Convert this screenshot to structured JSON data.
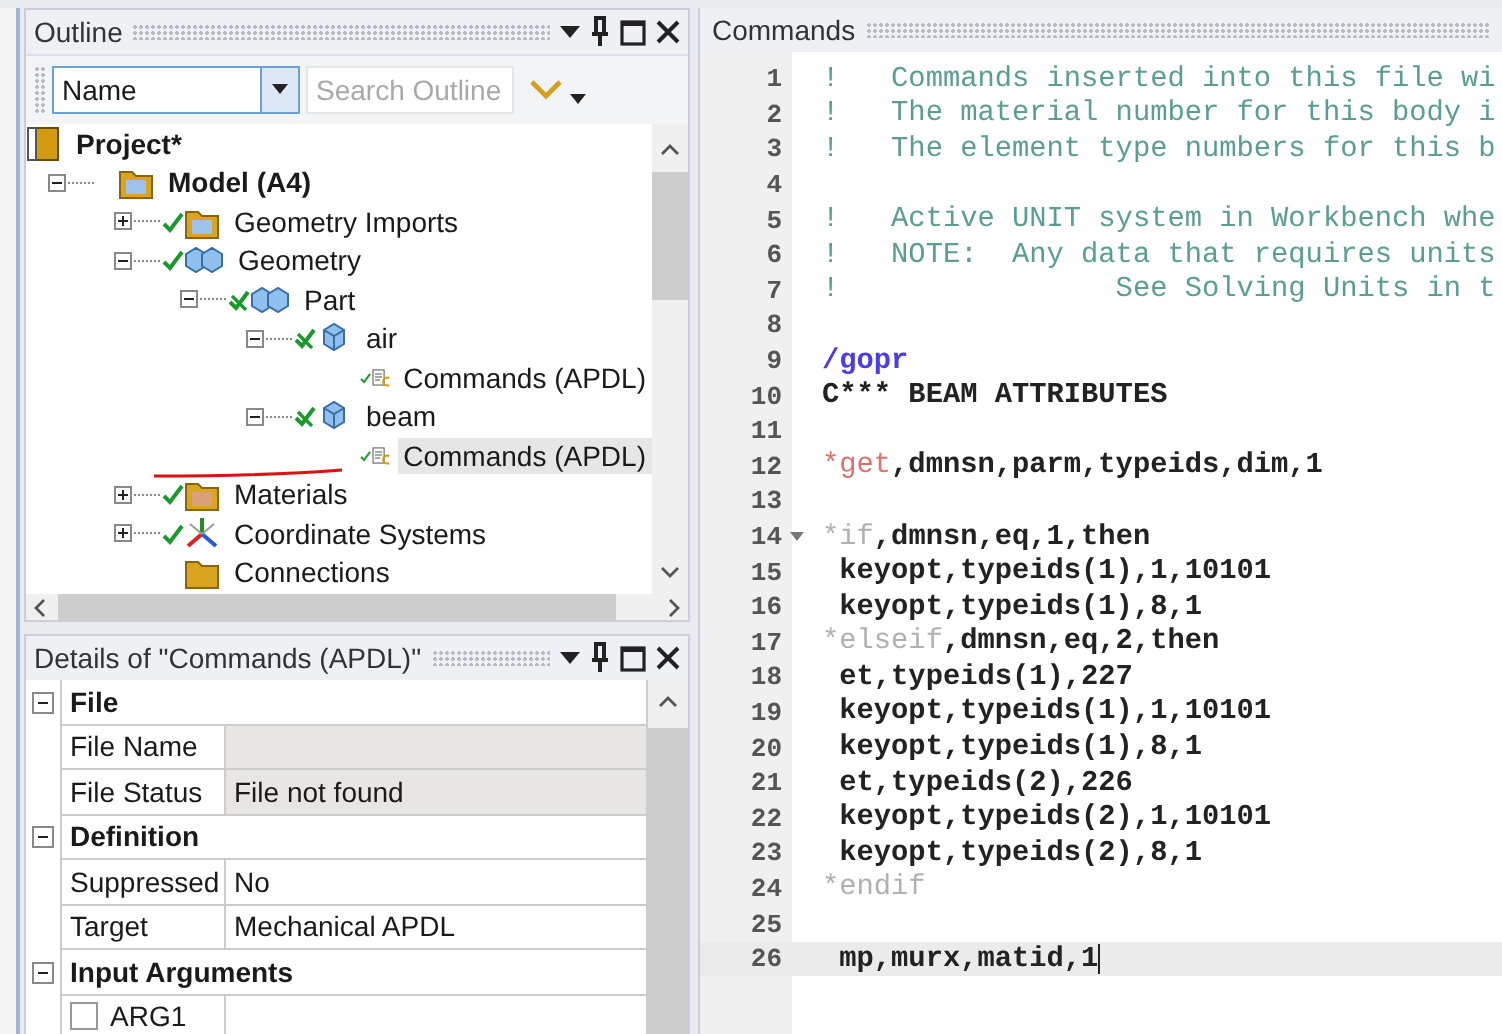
{
  "outline": {
    "title": "Outline",
    "filter": {
      "value": "Name"
    },
    "search": {
      "placeholder": "Search Outline"
    },
    "tree": [
      {
        "label": "Project*",
        "kind": "project",
        "selected": false,
        "children": [
          {
            "label": "Model (A4)",
            "kind": "model",
            "expanded": true,
            "selected": false,
            "children": [
              {
                "label": "Geometry Imports",
                "kind": "imports",
                "fully_defined": true,
                "expanded": false,
                "selected": false
              },
              {
                "label": "Geometry",
                "kind": "bodies",
                "fully_defined": true,
                "expanded": true,
                "selected": false,
                "children": [
                  {
                    "label": "Part",
                    "kind": "bodies",
                    "fully_defined": false,
                    "expanded": true,
                    "selected": false,
                    "children": [
                      {
                        "label": "air",
                        "kind": "body",
                        "fully_defined": false,
                        "expanded": true,
                        "selected": false,
                        "children": [
                          {
                            "label": "Commands (APDL)",
                            "kind": "commands",
                            "fully_defined": true,
                            "selected": false
                          }
                        ]
                      },
                      {
                        "label": "beam",
                        "kind": "body",
                        "fully_defined": false,
                        "expanded": true,
                        "selected": false,
                        "children": [
                          {
                            "label": "Commands (APDL)",
                            "kind": "commands",
                            "fully_defined": true,
                            "selected": true
                          }
                        ]
                      }
                    ]
                  }
                ]
              },
              {
                "label": "Materials",
                "kind": "materials",
                "fully_defined": true,
                "expanded": false,
                "selected": false
              },
              {
                "label": "Coordinate Systems",
                "kind": "axes",
                "fully_defined": true,
                "expanded": false,
                "selected": false
              },
              {
                "label": "Connections",
                "kind": "folder",
                "selected": false
              }
            ]
          }
        ]
      }
    ]
  },
  "details": {
    "title": "Details of \"Commands (APDL)\"",
    "rows": [
      {
        "kind": "group",
        "label": "File",
        "expanded": true
      },
      {
        "kind": "property",
        "name": "File Name",
        "readonly": true
      },
      {
        "kind": "property",
        "name": "File Status",
        "value": "File not found",
        "readonly": true
      },
      {
        "kind": "group",
        "label": "Definition",
        "expanded": true
      },
      {
        "kind": "property",
        "name": "Suppressed",
        "value": "No",
        "readonly": false
      },
      {
        "kind": "property",
        "name": "Target",
        "value": "Mechanical APDL",
        "readonly": false
      },
      {
        "kind": "group",
        "label": "Input Arguments",
        "expanded": true
      },
      {
        "kind": "checkbox",
        "name": "ARG1",
        "checked": false
      }
    ]
  },
  "commands": {
    "title": "Commands",
    "lines": [
      {
        "number": "1",
        "current": false,
        "segments": [
          {
            "kind": "comment",
            "text": "!   Commands inserted into this file wi"
          }
        ]
      },
      {
        "number": "2",
        "current": false,
        "segments": [
          {
            "kind": "comment",
            "text": "!   The material number for this body i"
          }
        ]
      },
      {
        "number": "3",
        "current": false,
        "segments": [
          {
            "kind": "comment",
            "text": "!   The element type numbers for this b"
          }
        ]
      },
      {
        "number": "4",
        "current": false
      },
      {
        "number": "5",
        "current": false,
        "segments": [
          {
            "kind": "comment",
            "text": "!   Active UNIT system in Workbench whe"
          }
        ]
      },
      {
        "number": "6",
        "current": false,
        "segments": [
          {
            "kind": "comment",
            "text": "!   NOTE:  Any data that requires units"
          }
        ]
      },
      {
        "number": "7",
        "current": false,
        "segments": [
          {
            "kind": "comment",
            "text": "!                See Solving Units in t"
          }
        ]
      },
      {
        "number": "8",
        "current": false
      },
      {
        "number": "9",
        "current": false,
        "segments": [
          {
            "kind": "directive",
            "text": "/gopr"
          }
        ]
      },
      {
        "number": "10",
        "current": false,
        "segments": [
          {
            "kind": "plain",
            "text": "C*** BEAM ATTRIBUTES"
          }
        ]
      },
      {
        "number": "11",
        "current": false
      },
      {
        "number": "12",
        "current": false,
        "segments": [
          {
            "kind": "star",
            "text": "*get"
          },
          {
            "kind": "plain",
            "text": ",dmnsn,parm,typeids,dim,1"
          }
        ]
      },
      {
        "number": "13",
        "current": false
      },
      {
        "number": "14",
        "current": false,
        "foldable": true,
        "segments": [
          {
            "kind": "control",
            "text": "*if"
          },
          {
            "kind": "plain",
            "text": ",dmnsn,eq,1,then"
          }
        ]
      },
      {
        "number": "15",
        "current": false,
        "segments": [
          {
            "kind": "plain",
            "text": " keyopt,typeids(1),1,10101"
          }
        ]
      },
      {
        "number": "16",
        "current": false,
        "segments": [
          {
            "kind": "plain",
            "text": " keyopt,typeids(1),8,1"
          }
        ]
      },
      {
        "number": "17",
        "current": false,
        "segments": [
          {
            "kind": "control",
            "text": "*elseif"
          },
          {
            "kind": "plain",
            "text": ",dmnsn,eq,2,then"
          }
        ]
      },
      {
        "number": "18",
        "current": false,
        "segments": [
          {
            "kind": "plain",
            "text": " et,typeids(1),227"
          }
        ]
      },
      {
        "number": "19",
        "current": false,
        "segments": [
          {
            "kind": "plain",
            "text": " keyopt,typeids(1),1,10101"
          }
        ]
      },
      {
        "number": "20",
        "current": false,
        "segments": [
          {
            "kind": "plain",
            "text": " keyopt,typeids(1),8,1"
          }
        ]
      },
      {
        "number": "21",
        "current": false,
        "segments": [
          {
            "kind": "plain",
            "text": " et,typeids(2),226"
          }
        ]
      },
      {
        "number": "22",
        "current": false,
        "segments": [
          {
            "kind": "plain",
            "text": " keyopt,typeids(2),1,10101"
          }
        ]
      },
      {
        "number": "23",
        "current": false,
        "segments": [
          {
            "kind": "plain",
            "text": " keyopt,typeids(2),8,1"
          }
        ]
      },
      {
        "number": "24",
        "current": false,
        "segments": [
          {
            "kind": "control",
            "text": "*endif"
          }
        ]
      },
      {
        "number": "25",
        "current": false
      },
      {
        "number": "26",
        "current": true,
        "segments": [
          {
            "kind": "plain",
            "text": " mp,murx,matid,1"
          }
        ]
      }
    ]
  }
}
